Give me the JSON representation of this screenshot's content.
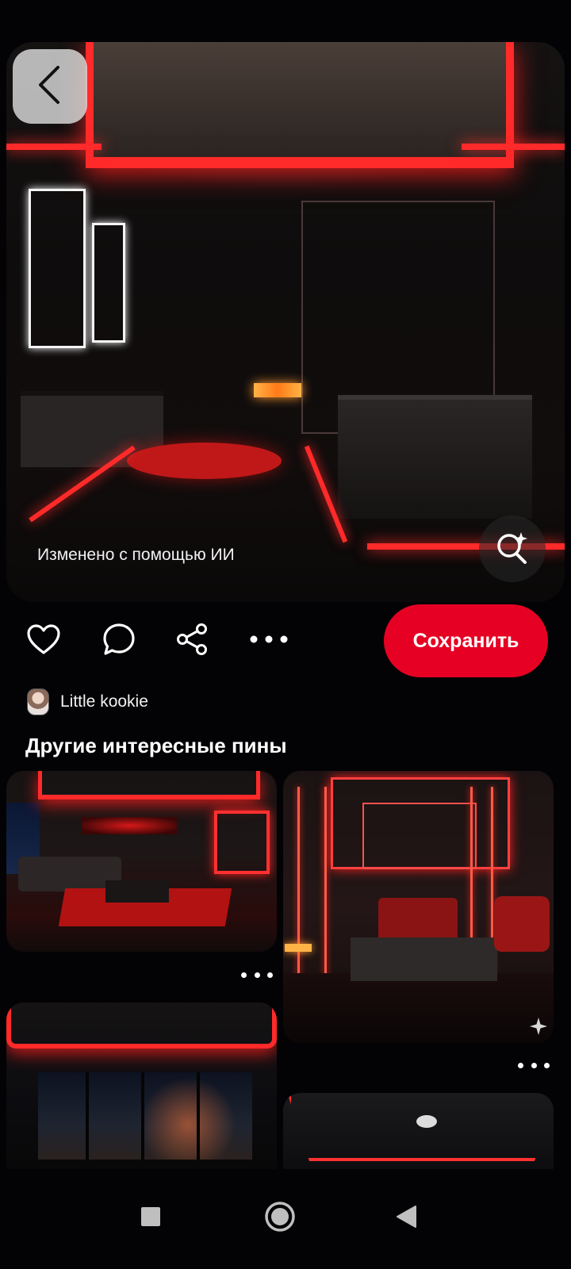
{
  "pin": {
    "ai_label": "Изменено с помощью ИИ",
    "save_label": "Сохранить"
  },
  "author": {
    "name": "Little kookie"
  },
  "related": {
    "title": "Другие интересные пины"
  },
  "colors": {
    "accent": "#e60023",
    "background": "#030305"
  },
  "icons": {
    "back": "chevron-left-icon",
    "lens": "visual-search-icon",
    "like": "heart-icon",
    "comment": "comment-icon",
    "share": "share-icon",
    "more": "more-horizontal-icon",
    "nav_recents": "square-icon",
    "nav_home": "circle-icon",
    "nav_back": "triangle-back-icon"
  }
}
